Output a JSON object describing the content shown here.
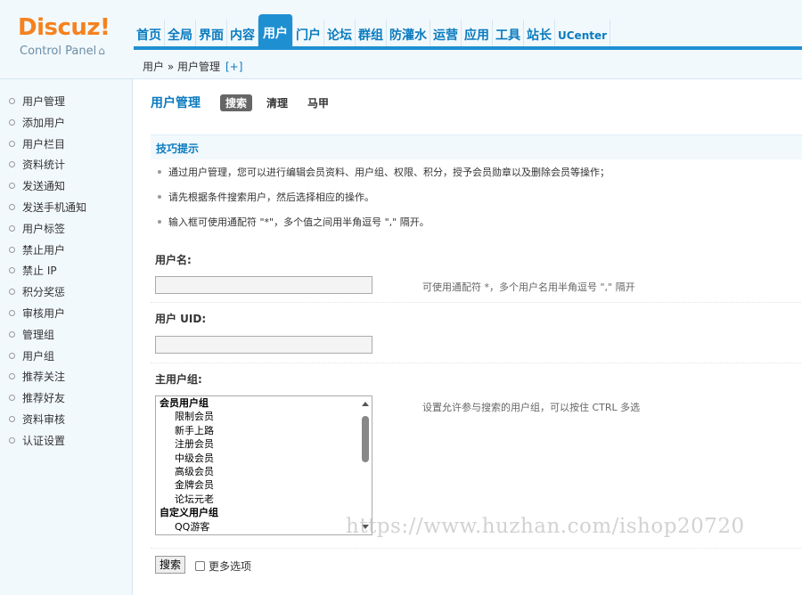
{
  "logo": {
    "title": "Discuz!",
    "subtitle": "Control Panel",
    "home_icon": "⌂"
  },
  "nav": {
    "items": [
      "首页",
      "全局",
      "界面",
      "内容",
      "用户",
      "门户",
      "论坛",
      "群组",
      "防灌水",
      "运营",
      "应用",
      "工具",
      "站长",
      "UCenter"
    ],
    "active": "用户"
  },
  "breadcrumb": {
    "text": "用户 » 用户管理",
    "plus": "[+]"
  },
  "sidebar": {
    "items": [
      "用户管理",
      "添加用户",
      "用户栏目",
      "资料统计",
      "发送通知",
      "发送手机通知",
      "用户标签",
      "禁止用户",
      "禁止 IP",
      "积分奖惩",
      "审核用户",
      "管理组",
      "用户组",
      "推荐关注",
      "推荐好友",
      "资料审核",
      "认证设置"
    ]
  },
  "main": {
    "title": "用户管理",
    "tabs": [
      "搜索",
      "清理",
      "马甲"
    ],
    "active_tab": "搜索",
    "tips_title": "技巧提示",
    "tips": [
      "通过用户管理，您可以进行编辑会员资料、用户组、权限、积分，授予会员勋章以及删除会员等操作；",
      "请先根据条件搜索用户，然后选择相应的操作。",
      "输入框可使用通配符 \"*\"，多个值之间用半角逗号 \",\" 隔开。"
    ],
    "username_label": "用户名:",
    "username_value": "",
    "username_hint": "可使用通配符 *，多个用户名用半角逗号 \",\" 隔开",
    "uid_label": "用户 UID:",
    "uid_value": "",
    "group_label": "主用户组:",
    "group_hint": "设置允许参与搜索的用户组，可以按住 CTRL 多选",
    "group_options": [
      {
        "label": "会员用户组",
        "type": "group"
      },
      {
        "label": "限制会员",
        "type": "child"
      },
      {
        "label": "新手上路",
        "type": "child"
      },
      {
        "label": "注册会员",
        "type": "child"
      },
      {
        "label": "中级会员",
        "type": "child"
      },
      {
        "label": "高级会员",
        "type": "child"
      },
      {
        "label": "金牌会员",
        "type": "child"
      },
      {
        "label": "论坛元老",
        "type": "child"
      },
      {
        "label": "自定义用户组",
        "type": "group"
      },
      {
        "label": "QQ游客",
        "type": "child"
      }
    ],
    "search_button": "搜索",
    "more_options": "更多选项"
  },
  "watermark": "https://www.huzhan.com/ishop20720"
}
